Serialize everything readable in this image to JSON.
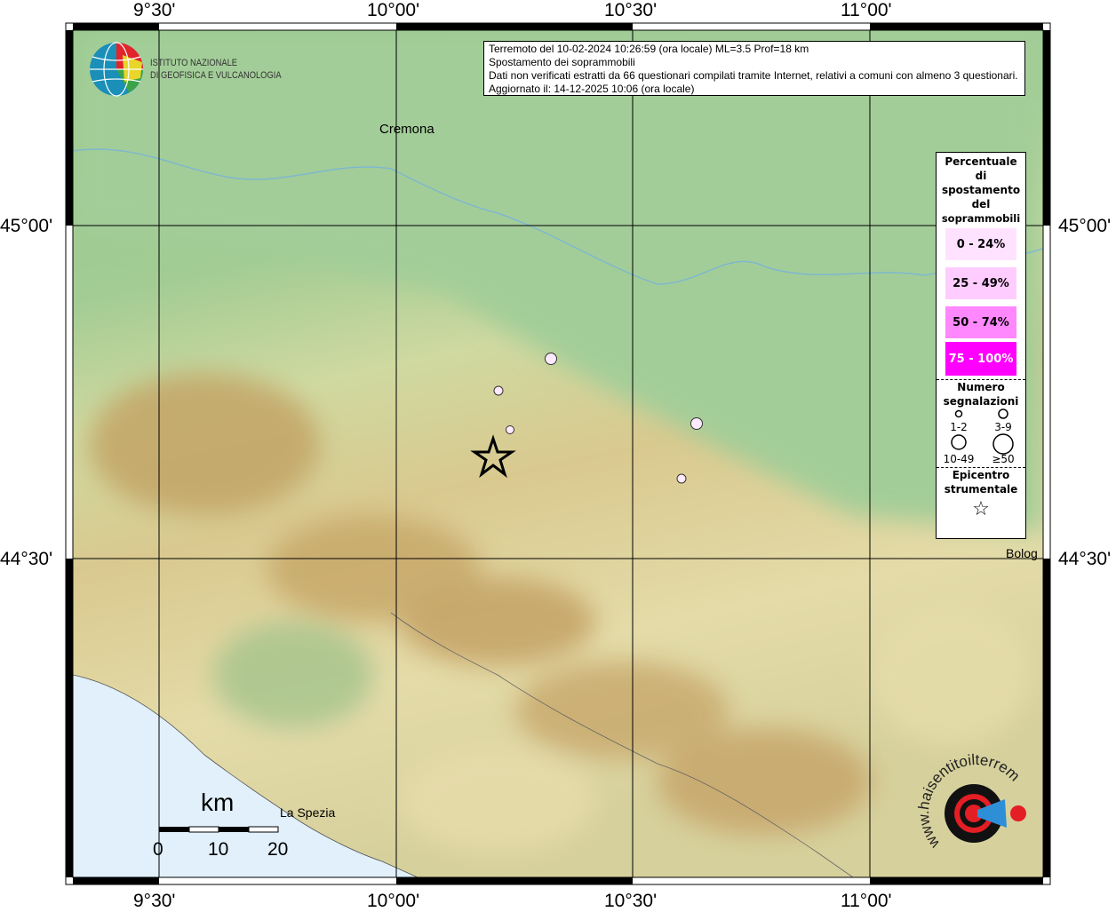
{
  "map": {
    "lon_ticks": [
      "9°30'",
      "10°00'",
      "10°30'",
      "11°00'"
    ],
    "lat_ticks": [
      "45°00'",
      "44°30'"
    ],
    "places": {
      "cremona": "Cremona",
      "la_spezia": "La Spezia",
      "bologna": "Bolog"
    },
    "scale": {
      "unit": "km",
      "labels": [
        "0",
        "10",
        "20"
      ]
    }
  },
  "info": {
    "line1": "Terremoto del 10-02-2024 10:26:59 (ora locale) ML=3.5 Prof=18 km",
    "line2": "Spostamento dei soprammobili",
    "line3": "Dati non verificati estratti da 66 questionari compilati tramite Internet, relativi a comuni con almeno 3 questionari.",
    "line4": "Aggiornato il: 14-12-2025 10:06 (ora locale)"
  },
  "logo_ingv": {
    "line1": "ISTITUTO NAZIONALE",
    "line2": "DI GEOFISICA E VULCANOLOGIA"
  },
  "logo_hsit": {
    "text": "www.haisentitoilterremoto.it"
  },
  "legend": {
    "title": [
      "Percentuale",
      "di",
      "spostamento",
      "del",
      "soprammobili"
    ],
    "classes": [
      {
        "label": "0 - 24%",
        "color": "#ffe2ff"
      },
      {
        "label": "25 - 49%",
        "color": "#ffccff"
      },
      {
        "label": "50 - 74%",
        "color": "#ff88ff"
      },
      {
        "label": "75 - 100%",
        "color": "#ff00ff"
      }
    ],
    "count_title": [
      "Numero",
      "segnalazioni"
    ],
    "count_classes": [
      "1-2",
      "3-9",
      "10-49",
      "≥50"
    ],
    "epicenter_title": [
      "Epicentro",
      "strumentale"
    ]
  },
  "points": [
    {
      "class": "0 - 24%",
      "count": "3-9",
      "lon": 10.32,
      "lat": 44.8
    },
    {
      "class": "0 - 24%",
      "count": "1-2",
      "lon": 10.21,
      "lat": 44.75
    },
    {
      "class": "0 - 24%",
      "count": "1-2",
      "lon": 10.24,
      "lat": 44.69
    },
    {
      "class": "0 - 24%",
      "count": "3-9",
      "lon": 10.63,
      "lat": 44.7
    },
    {
      "class": "0 - 24%",
      "count": "1-2",
      "lon": 10.6,
      "lat": 44.62
    }
  ],
  "epicenter": {
    "lon": 10.21,
    "lat": 44.65
  }
}
